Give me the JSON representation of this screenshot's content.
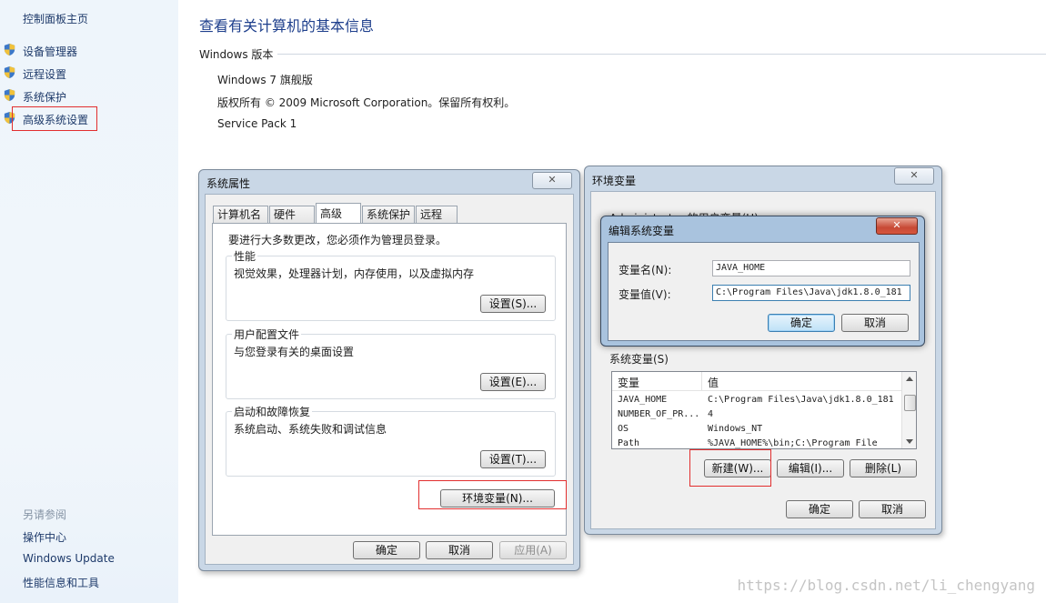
{
  "left_nav": {
    "home": "控制面板主页",
    "items": [
      "设备管理器",
      "远程设置",
      "系统保护",
      "高级系统设置"
    ],
    "see_also": {
      "title": "另请参阅",
      "items": [
        "操作中心",
        "Windows Update",
        "性能信息和工具"
      ]
    }
  },
  "main": {
    "title": "查看有关计算机的基本信息",
    "section": "Windows 版本",
    "edition": "Windows 7 旗舰版",
    "copyright": "版权所有 © 2009 Microsoft Corporation。保留所有权利。",
    "service_pack": "Service Pack 1"
  },
  "system_properties": {
    "title": "系统属性",
    "tabs": [
      "计算机名",
      "硬件",
      "高级",
      "系统保护",
      "远程"
    ],
    "active_tab": "高级",
    "admin_note": "要进行大多数更改，您必须作为管理员登录。",
    "groups": [
      {
        "title": "性能",
        "desc": "视觉效果，处理器计划，内存使用，以及虚拟内存",
        "button": "设置(S)..."
      },
      {
        "title": "用户配置文件",
        "desc": "与您登录有关的桌面设置",
        "button": "设置(E)..."
      },
      {
        "title": "启动和故障恢复",
        "desc": "系统启动、系统失败和调试信息",
        "button": "设置(T)..."
      }
    ],
    "env_button": "环境变量(N)...",
    "ok": "确定",
    "cancel": "取消",
    "apply": "应用(A)"
  },
  "env_vars": {
    "title": "环境变量",
    "user_section": "Administrator 的用户变量(U)",
    "system_section": "系统变量(S)",
    "columns": [
      "变量",
      "值"
    ],
    "rows": [
      {
        "name": "JAVA_HOME",
        "value": "C:\\Program Files\\Java\\jdk1.8.0_181"
      },
      {
        "name": "NUMBER_OF_PR...",
        "value": "4"
      },
      {
        "name": "OS",
        "value": "Windows_NT"
      },
      {
        "name": "Path",
        "value": "%JAVA_HOME%\\bin;C:\\Program File"
      }
    ],
    "new_button": "新建(W)...",
    "edit_button": "编辑(I)...",
    "delete_button": "删除(L)",
    "ok": "确定",
    "cancel": "取消"
  },
  "edit_var": {
    "title": "编辑系统变量",
    "name_label": "变量名(N):",
    "name_value": "JAVA_HOME",
    "value_label": "变量值(V):",
    "value_value": "C:\\Program Files\\Java\\jdk1.8.0_181",
    "ok": "确定",
    "cancel": "取消"
  },
  "close_glyph": "✕",
  "watermark": "https://blog.csdn.net/li_chengyang",
  "icons": {
    "nav": "shield-icon",
    "close": "close-icon",
    "scroll_up": "scroll-up-icon",
    "scroll_down": "scroll-down-icon"
  },
  "colors": {
    "nav_bg": "#eef5fb",
    "title_blue": "#1e3f8c",
    "highlight_red": "#e22e2e",
    "dialog_frame": "#c9d7e6"
  }
}
